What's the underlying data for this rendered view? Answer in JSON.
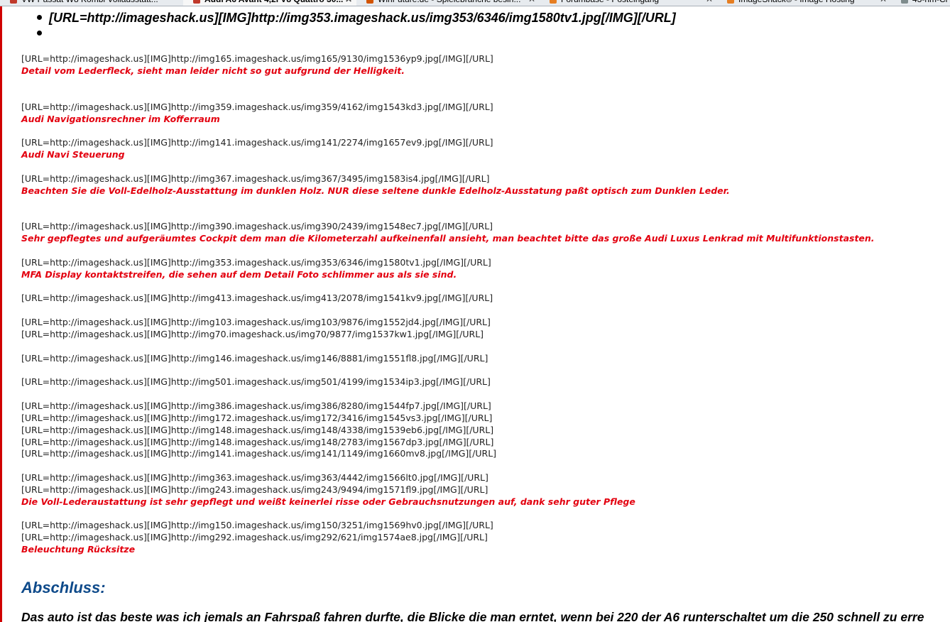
{
  "tabs": [
    {
      "label": "VW Passat W8 Kombi Vollausstatt...",
      "favicon_color": "#c0392b"
    },
    {
      "label": "Audi A6 Avant 4,2l V8 Quattro 30...",
      "favicon_color": "#c0392b",
      "close": "✕"
    },
    {
      "label": "WinFuture.de - Spielebranche besin...",
      "favicon_color": "#d35400",
      "close": "✕"
    },
    {
      "label": "Forumbase - Posteingang",
      "favicon_color": "#e67e22",
      "close": "✕"
    },
    {
      "label": "ImageShack® - Image Hosting",
      "favicon_color": "#e67e22",
      "close": "✕"
    },
    {
      "label": "43-hm-Cr",
      "favicon_color": "#7f8c8d"
    }
  ],
  "bullet_list": [
    "[URL=http://imageshack.us][IMG]http://img353.imageshack.us/img353/6346/img1580tv1.jpg[/IMG][/URL]",
    ""
  ],
  "lines": [
    {
      "type": "url",
      "text": "[URL=http://imageshack.us][IMG]http://img165.imageshack.us/img165/9130/img1536yp9.jpg[/IMG][/URL]"
    },
    {
      "type": "cap",
      "text": "Detail vom Lederfleck, sieht man leider nicht so gut aufgrund der Helligkeit."
    },
    {
      "type": "url",
      "text": "[URL=http://imageshack.us][IMG]http://img359.imageshack.us/img359/4162/img1543kd3.jpg[/IMG][/URL]"
    },
    {
      "type": "cap",
      "text": "Audi Navigationsrechner im Kofferraum"
    },
    {
      "type": "url",
      "text": "[URL=http://imageshack.us][IMG]http://img141.imageshack.us/img141/2274/img1657ev9.jpg[/IMG][/URL]"
    },
    {
      "type": "cap",
      "text": "Audi Navi Steuerung"
    },
    {
      "type": "url",
      "text": "[URL=http://imageshack.us][IMG]http://img367.imageshack.us/img367/3495/img1583is4.jpg[/IMG][/URL]"
    },
    {
      "type": "cap",
      "text": "Beachten Sie die Voll-Edelholz-Ausstattung im dunklen Holz. NUR diese seltene dunkle Edelholz-Ausstatung paßt optisch zum Dunklen Leder."
    },
    {
      "type": "url",
      "text": "[URL=http://imageshack.us][IMG]http://img390.imageshack.us/img390/2439/img1548ec7.jpg[/IMG][/URL]"
    },
    {
      "type": "cap",
      "text": "Sehr gepflegtes und aufgeräumtes Cockpit dem man die Kilometerzahl aufkeinenfall ansieht, man beachtet bitte das große Audi Luxus Lenkrad mit Multifunktionstasten."
    },
    {
      "type": "url",
      "text": "[URL=http://imageshack.us][IMG]http://img353.imageshack.us/img353/6346/img1580tv1.jpg[/IMG][/URL]"
    },
    {
      "type": "cap",
      "text": "MFA Display kontaktstreifen, die sehen auf dem Detail Foto schlimmer aus als sie sind."
    },
    {
      "type": "url",
      "text": "[URL=http://imageshack.us][IMG]http://img413.imageshack.us/img413/2078/img1541kv9.jpg[/IMG][/URL]"
    },
    {
      "type": "url",
      "text": "[URL=http://imageshack.us][IMG]http://img103.imageshack.us/img103/9876/img1552jd4.jpg[/IMG][/URL]"
    },
    {
      "type": "url",
      "text": "[URL=http://imageshack.us][IMG]http://img70.imageshack.us/img70/9877/img1537kw1.jpg[/IMG][/URL]"
    },
    {
      "type": "url",
      "text": "[URL=http://imageshack.us][IMG]http://img146.imageshack.us/img146/8881/img1551fl8.jpg[/IMG][/URL]"
    },
    {
      "type": "url",
      "text": "[URL=http://imageshack.us][IMG]http://img501.imageshack.us/img501/4199/img1534ip3.jpg[/IMG][/URL]"
    },
    {
      "type": "url",
      "text": "[URL=http://imageshack.us][IMG]http://img386.imageshack.us/img386/8280/img1544fp7.jpg[/IMG][/URL]"
    },
    {
      "type": "url",
      "text": "[URL=http://imageshack.us][IMG]http://img172.imageshack.us/img172/3416/img1545vs3.jpg[/IMG][/URL]"
    },
    {
      "type": "url",
      "text": "[URL=http://imageshack.us][IMG]http://img148.imageshack.us/img148/4338/img1539eb6.jpg[/IMG][/URL]"
    },
    {
      "type": "url",
      "text": "[URL=http://imageshack.us][IMG]http://img148.imageshack.us/img148/2783/img1567dp3.jpg[/IMG][/URL]"
    },
    {
      "type": "url",
      "text": "[URL=http://imageshack.us][IMG]http://img141.imageshack.us/img141/1149/img1660mv8.jpg[/IMG][/URL]"
    },
    {
      "type": "url",
      "text": "[URL=http://imageshack.us][IMG]http://img363.imageshack.us/img363/4442/img1566lt0.jpg[/IMG][/URL]"
    },
    {
      "type": "url",
      "text": "[URL=http://imageshack.us][IMG]http://img243.imageshack.us/img243/9494/img1571fl9.jpg[/IMG][/URL]"
    },
    {
      "type": "cap",
      "text": "Die Voll-Lederaustattung ist sehr gepflegt und weißt keinerlei risse oder Gebrauchsnutzungen auf, dank sehr guter Pflege"
    },
    {
      "type": "url",
      "text": "[URL=http://imageshack.us][IMG]http://img150.imageshack.us/img150/3251/img1569hv0.jpg[/IMG][/URL]"
    },
    {
      "type": "url",
      "text": "[URL=http://imageshack.us][IMG]http://img292.imageshack.us/img292/621/img1574ae8.jpg[/IMG][/URL]"
    },
    {
      "type": "cap",
      "text": "Beleuchtung Rücksitze"
    }
  ],
  "heading": "Abschluss:",
  "closing_text": "Das auto ist das beste was ich jemals an Fahrspaß fahren durfte, die Blicke die man erntet, wenn bei 220 der A6 runterschaltet um die 250 schnell zu erre",
  "colors": {
    "caption": "#e3000f",
    "heading": "#0e4a8a",
    "left_border": "#d00000"
  }
}
